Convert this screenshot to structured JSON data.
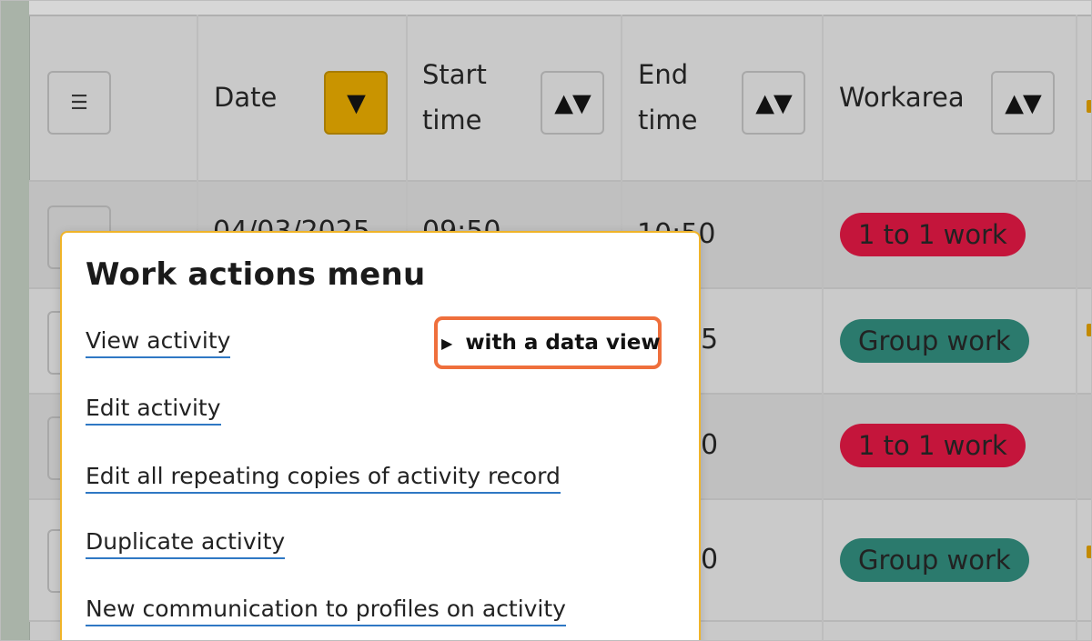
{
  "table": {
    "menu_icon": "☰",
    "columns": [
      {
        "label": "Date",
        "sort_icon": "▼",
        "active": true
      },
      {
        "label_line1": "Start",
        "label_line2": "time",
        "sort_icon": "▲▼"
      },
      {
        "label_line1": "End",
        "label_line2": "time",
        "sort_icon": "▲▼"
      },
      {
        "label": "Workarea",
        "sort_icon": "▲▼"
      }
    ],
    "rows": [
      {
        "date": "04/03/2025",
        "start": "09:50",
        "end": "10:50",
        "workarea": "1 to 1 work",
        "workarea_color": "#c4153b"
      },
      {
        "end": "5",
        "workarea": "Group work",
        "workarea_color": "#2b7a6d"
      },
      {
        "end": "0",
        "workarea": "1 to 1 work",
        "workarea_color": "#c4153b"
      },
      {
        "end": "0",
        "workarea": "Group work",
        "workarea_color": "#2b7a6d"
      }
    ]
  },
  "popup": {
    "title": "Work actions menu",
    "items": [
      {
        "label": "View activity"
      },
      {
        "label": "Edit activity"
      },
      {
        "label": "Edit all repeating copies of activity record"
      },
      {
        "label": "Duplicate activity"
      },
      {
        "label": "New communication to profiles on activity"
      }
    ],
    "data_view": {
      "icon": "▶",
      "label": "with a data view"
    }
  },
  "colors": {
    "accent_highlight": "#ef6f3c",
    "popup_border": "#f0b429",
    "sort_active": "#c99400",
    "link_underline": "#2f78c4"
  }
}
